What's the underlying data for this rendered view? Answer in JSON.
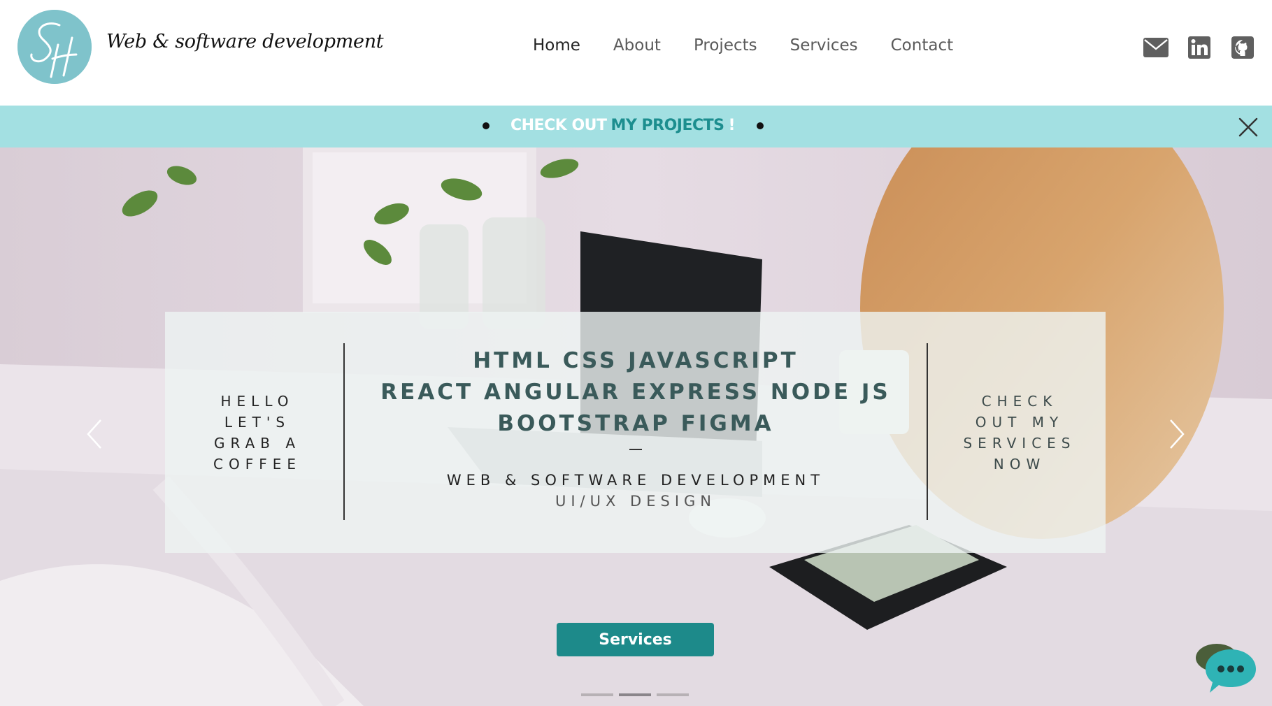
{
  "header": {
    "brand": "Web & software development",
    "logo_letters": "SH",
    "nav": [
      "Home",
      "About",
      "Projects",
      "Services",
      "Contact"
    ],
    "active_nav": "Home",
    "social_icons": [
      "email-icon",
      "linkedin-icon",
      "github-icon"
    ]
  },
  "announcement": {
    "part1": "CHECK OUT",
    "part2": "MY PROJECTS",
    "part3": "!",
    "close_icon": "close-icon"
  },
  "hero": {
    "left_lines": [
      "HELLO",
      "LET'S",
      "GRAB A",
      "COFFEE"
    ],
    "skills_lines": [
      "HTML  CSS  JAVASCRIPT",
      "REACT  ANGULAR  EXPRESS  NODE JS",
      "BOOTSTRAP  FIGMA"
    ],
    "dash": "–",
    "sub_lines": [
      "WEB & SOFTWARE DEVELOPMENT",
      "UI/UX DESIGN"
    ],
    "right_lines": [
      "CHECK",
      "OUT MY",
      "SERVICES",
      "NOW"
    ],
    "button_label": "Services",
    "slide_count": 3,
    "active_slide": 2
  },
  "colors": {
    "accent": "#1d8a8a",
    "banner": "#a3e0e2",
    "logo": "#7fc3cb"
  }
}
